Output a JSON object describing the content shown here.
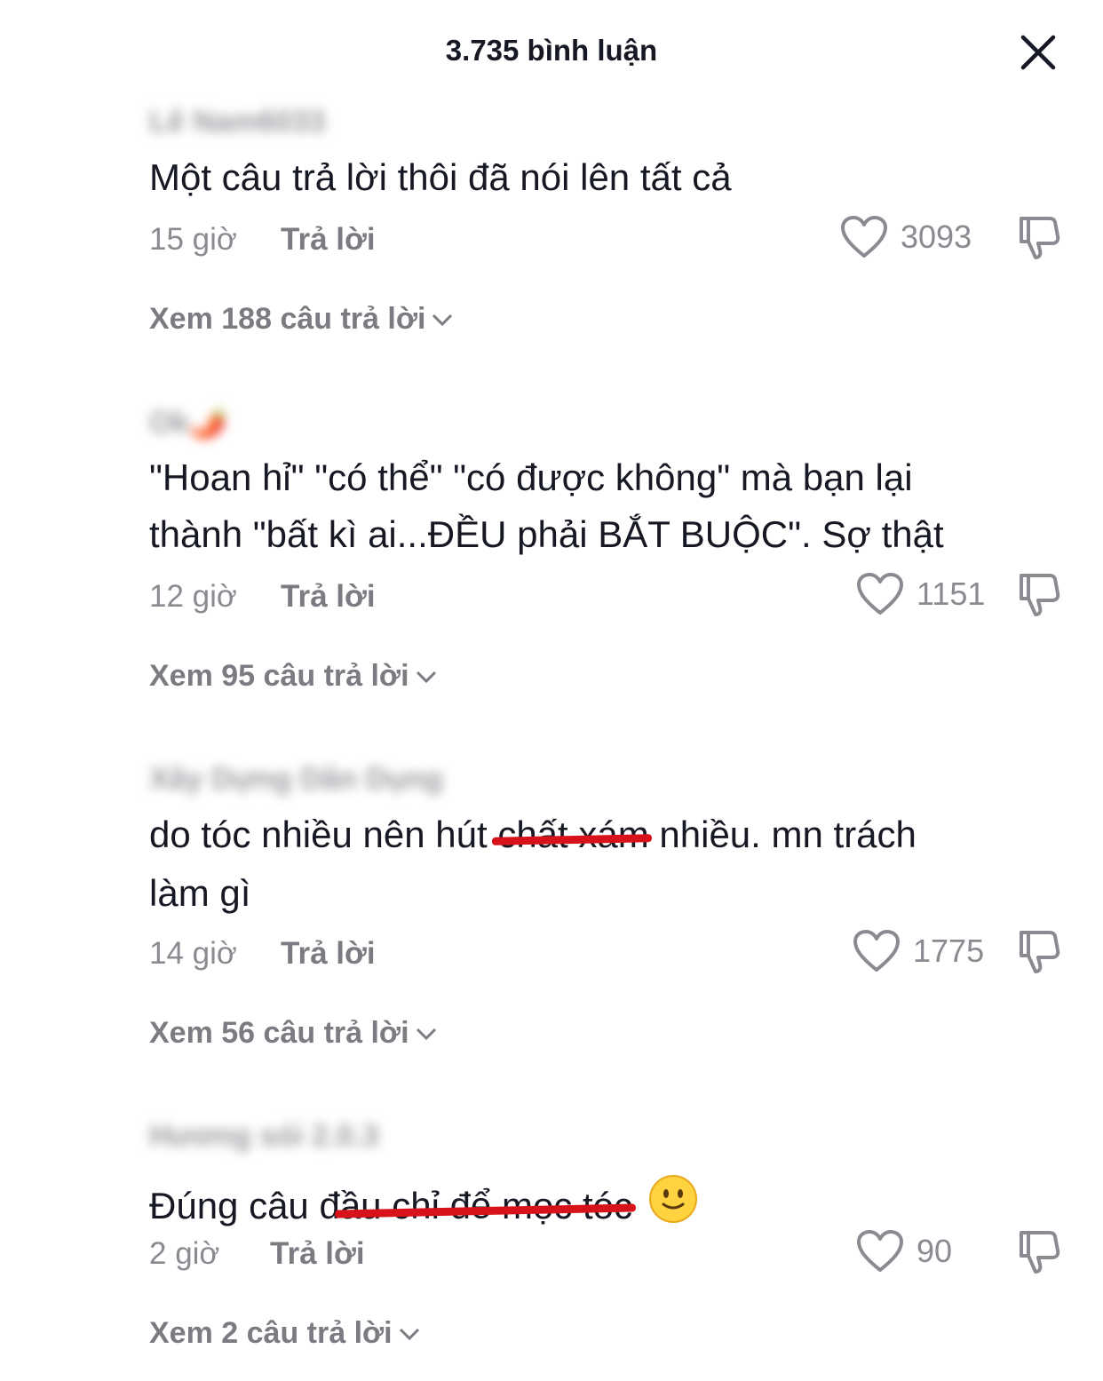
{
  "header": {
    "title": "3.735 bình luận",
    "close_icon": "close-icon"
  },
  "comments": [
    {
      "username": "Lê Nam6033",
      "text": "Một câu trả lời thôi đã nói lên tất cả",
      "time": "15 giờ",
      "reply_label": "Trả lời",
      "likes": "3093",
      "view_replies": "Xem 188 câu trả lời"
    },
    {
      "username": "Ok🌶️",
      "text_line1": "\"Hoan hỉ\" \"có thể\" \"có được không\" mà bạn lại",
      "text_line2": "thành \"bất kì ai...ĐỀU phải BẮT BUỘC\". Sợ thật",
      "time": "12 giờ",
      "reply_label": "Trả lời",
      "likes": "1151",
      "view_replies": "Xem 95 câu trả lời"
    },
    {
      "username": "Xây Dựng Dân Dụng",
      "text_before": "do tóc nhiều nên hút ",
      "text_struck": "chất xám",
      "text_after": " nhiều. mn trách",
      "text_line2": "làm gì",
      "time": "14 giờ",
      "reply_label": "Trả lời",
      "likes": "1775",
      "view_replies": "Xem 56 câu trả lời"
    },
    {
      "username": "Hương sói 2.0.3",
      "text_before": "Đúng câu đ",
      "text_struck": "ầu chỉ để mọc tóc",
      "emoji": "slightly-smiling-face",
      "time": "2 giờ",
      "reply_label": "Trả lời",
      "likes": "90",
      "view_replies": "Xem 2 câu trả lời"
    }
  ],
  "colors": {
    "text": "#161823",
    "muted": "#8a8b91",
    "strike": "#d8121a"
  }
}
